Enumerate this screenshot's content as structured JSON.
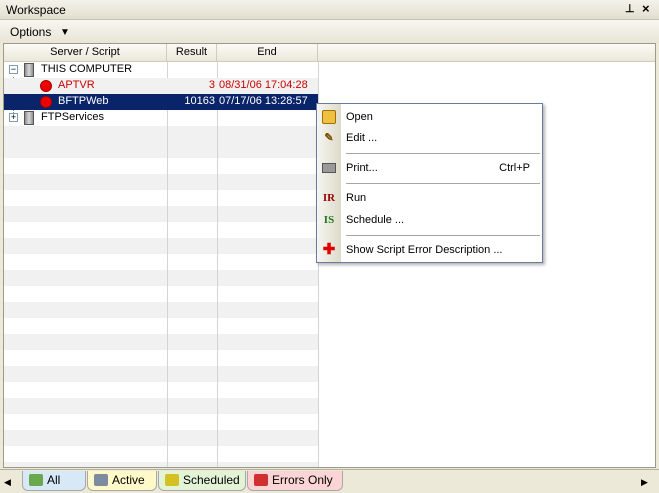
{
  "window": {
    "title": "Workspace",
    "pin_glyph": "⊥",
    "close_glyph": "×"
  },
  "toolbar": {
    "options_label": "Options",
    "options_arrow": "▼"
  },
  "columns": {
    "server": "Server / Script",
    "result": "Result",
    "end": "End"
  },
  "tree": {
    "computer": {
      "label": "THIS COMPUTER",
      "expander": "−"
    },
    "scripts": [
      {
        "name": "APTVR",
        "result": "3",
        "end": "08/31/06 17:04:28",
        "status": "error"
      },
      {
        "name": "BFTPWeb",
        "result": "10163",
        "end": "07/17/06 13:28:57",
        "status": "error",
        "selected": true
      }
    ],
    "ftp": {
      "label": "FTPServices",
      "expander": "+"
    }
  },
  "context_menu": {
    "open": "Open",
    "edit": "Edit ...",
    "print": "Print...",
    "print_shortcut": "Ctrl+P",
    "run": "Run",
    "schedule": "Schedule ...",
    "show_error": "Show Script Error Description ...",
    "icons": {
      "open": "folder-open-icon",
      "edit": "edit-icon",
      "print": "printer-icon",
      "run": "run-script-icon",
      "schedule": "schedule-icon",
      "show_error": "red-cross-icon"
    }
  },
  "tabs": [
    {
      "label": "All",
      "color": "#d7e8f7"
    },
    {
      "label": "Active",
      "color": "#fff9c9"
    },
    {
      "label": "Scheduled",
      "color": "#e3f3d6"
    },
    {
      "label": "Errors Only",
      "color": "#fbd5d5"
    }
  ],
  "colors": {
    "selection": "#0a246a",
    "error_text": "#cc0000",
    "error_dot": "#ee0000"
  }
}
